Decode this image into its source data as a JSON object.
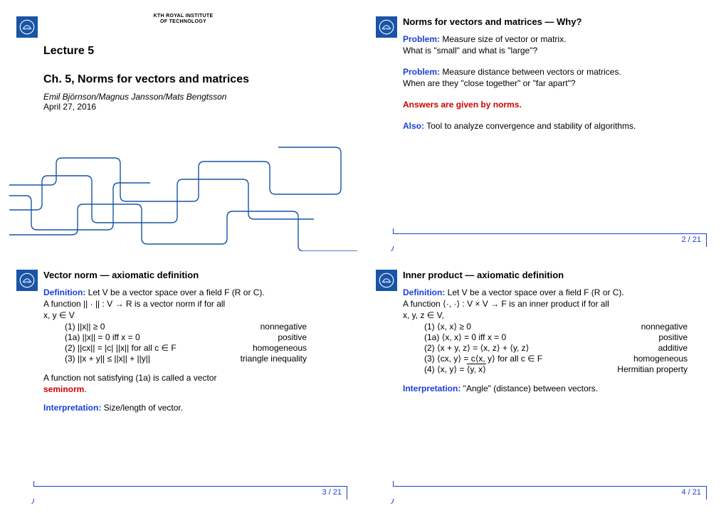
{
  "institute": {
    "line1": "KTH ROYAL INSTITUTE",
    "line2": "OF TECHNOLOGY"
  },
  "slide1": {
    "lecture": "Lecture 5",
    "chapter": "Ch. 5, Norms for vectors and matrices",
    "authors": "Emil Björnson/Magnus Jansson/Mats Bengtsson",
    "date": "April 27, 2016"
  },
  "slide2": {
    "title": "Norms for vectors and matrices — Why?",
    "problem1_label": "Problem:",
    "problem1_a": " Measure size of vector or matrix.",
    "problem1_b": "What is \"small\" and what is \"large\"?",
    "problem2_label": "Problem:",
    "problem2_a": " Measure distance between vectors or matrices.",
    "problem2_b": "When are they \"close together\" or \"far apart\"?",
    "answers": "Answers are given by norms.",
    "also_label": "Also:",
    "also_text": " Tool to analyze convergence and stability of algorithms.",
    "page": "2 / 21"
  },
  "slide3": {
    "title": "Vector norm — axiomatic definition",
    "def_label": "Definition:",
    "def1": " Let V be a vector space over a field F (R or C).",
    "def2": "A function || · || : V → R is a vector norm if for all",
    "def3": "x, y ∈ V",
    "p1l": "(1) ||x|| ≥ 0",
    "p1r": "nonnegative",
    "p1al": "(1a) ||x|| = 0 iff x = 0",
    "p1ar": "positive",
    "p2l": "(2) ||cx|| = |c| ||x|| for all c ∈ F",
    "p2r": "homogeneous",
    "p3l": "(3) ||x + y|| ≤ ||x|| + ||y||",
    "p3r": "triangle inequality",
    "semi1": "A function not satisfying (1a) is called a vector",
    "semi2": "seminorm",
    "semi2b": ".",
    "interp_label": "Interpretation:",
    "interp_text": " Size/length of vector.",
    "page": "3 / 21"
  },
  "slide4": {
    "title": "Inner product — axiomatic definition",
    "def_label": "Definition:",
    "def1": " Let V be a vector space over a field F (R or C).",
    "def2": "A function ⟨·, ·⟩ : V × V → F is an inner product if for all",
    "def3": "x, y, z ∈ V,",
    "p1l": "(1) ⟨x, x⟩ ≥ 0",
    "p1r": "nonnegative",
    "p1al": "(1a) ⟨x, x⟩ = 0 iff x = 0",
    "p1ar": "positive",
    "p2l": "(2) ⟨x + y, z⟩ = ⟨x, z⟩ + ⟨y, z⟩",
    "p2r": "additive",
    "p3l": "(3) ⟨cx, y⟩ = c⟨x, y⟩ for all c ∈ F",
    "p3r": "homogeneous",
    "p4la": "(4) ⟨x, y⟩ = ",
    "p4lb": "⟨y, x⟩",
    "p4r": "Hermitian property",
    "interp_label": "Interpretation:",
    "interp_text": " \"Angle\" (distance) between vectors.",
    "page": "4 / 21"
  }
}
